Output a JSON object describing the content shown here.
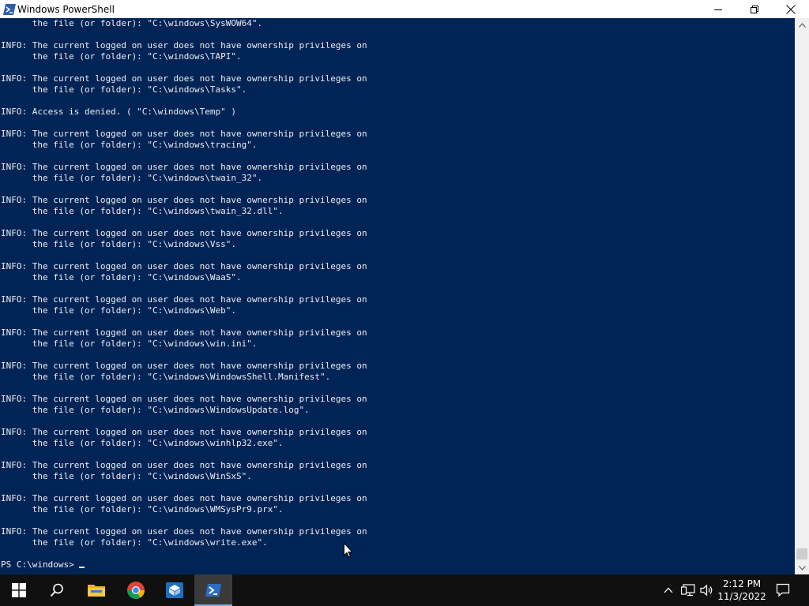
{
  "window": {
    "title": "Windows PowerShell",
    "controls": {
      "minimize": "minimize",
      "maximize": "restore",
      "close": "close"
    }
  },
  "console": {
    "lines": [
      "      the file (or folder): \"C:\\windows\\SysWOW64\".",
      "",
      "INFO: The current logged on user does not have ownership privileges on",
      "      the file (or folder): \"C:\\windows\\TAPI\".",
      "",
      "INFO: The current logged on user does not have ownership privileges on",
      "      the file (or folder): \"C:\\windows\\Tasks\".",
      "",
      "INFO: Access is denied. ( \"C:\\windows\\Temp\" )",
      "",
      "INFO: The current logged on user does not have ownership privileges on",
      "      the file (or folder): \"C:\\windows\\tracing\".",
      "",
      "INFO: The current logged on user does not have ownership privileges on",
      "      the file (or folder): \"C:\\windows\\twain_32\".",
      "",
      "INFO: The current logged on user does not have ownership privileges on",
      "      the file (or folder): \"C:\\windows\\twain_32.dll\".",
      "",
      "INFO: The current logged on user does not have ownership privileges on",
      "      the file (or folder): \"C:\\windows\\Vss\".",
      "",
      "INFO: The current logged on user does not have ownership privileges on",
      "      the file (or folder): \"C:\\windows\\WaaS\".",
      "",
      "INFO: The current logged on user does not have ownership privileges on",
      "      the file (or folder): \"C:\\windows\\Web\".",
      "",
      "INFO: The current logged on user does not have ownership privileges on",
      "      the file (or folder): \"C:\\windows\\win.ini\".",
      "",
      "INFO: The current logged on user does not have ownership privileges on",
      "      the file (or folder): \"C:\\windows\\WindowsShell.Manifest\".",
      "",
      "INFO: The current logged on user does not have ownership privileges on",
      "      the file (or folder): \"C:\\windows\\WindowsUpdate.log\".",
      "",
      "INFO: The current logged on user does not have ownership privileges on",
      "      the file (or folder): \"C:\\windows\\winhlp32.exe\".",
      "",
      "INFO: The current logged on user does not have ownership privileges on",
      "      the file (or folder): \"C:\\windows\\WinSxS\".",
      "",
      "INFO: The current logged on user does not have ownership privileges on",
      "      the file (or folder): \"C:\\windows\\WMSysPr9.prx\".",
      "",
      "INFO: The current logged on user does not have ownership privileges on",
      "      the file (or folder): \"C:\\windows\\write.exe\".",
      ""
    ],
    "prompt": "PS C:\\windows> "
  },
  "scrollbar": {
    "position": 0.98
  },
  "taskbar": {
    "apps": [
      {
        "name": "start",
        "icon": "windows-logo-icon"
      },
      {
        "name": "search",
        "icon": "search-icon"
      },
      {
        "name": "file-explorer",
        "icon": "folder-icon"
      },
      {
        "name": "chrome",
        "icon": "chrome-icon"
      },
      {
        "name": "sandbox",
        "icon": "box-icon"
      },
      {
        "name": "powershell",
        "icon": "powershell-icon",
        "active": true
      }
    ],
    "tray": {
      "time": "2:12 PM",
      "date": "11/3/2022"
    }
  },
  "colors": {
    "console_bg": "#012456",
    "console_fg": "#eeedf0",
    "taskbar_bg": "#101010",
    "accent": "#7aa9e3"
  }
}
